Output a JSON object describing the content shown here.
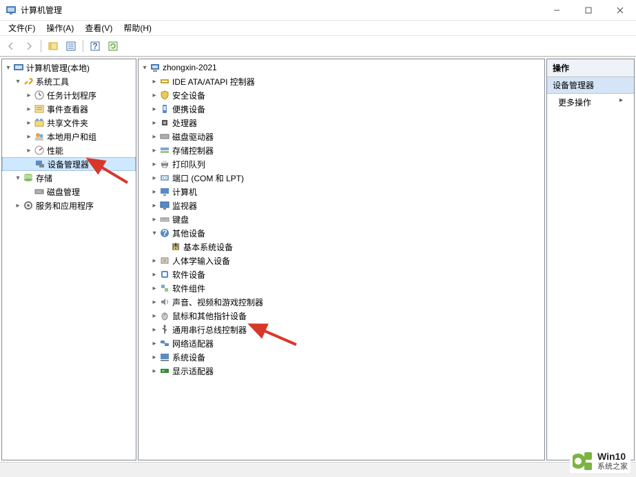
{
  "window": {
    "title": "计算机管理"
  },
  "menu": {
    "file": "文件(F)",
    "action": "操作(A)",
    "view": "查看(V)",
    "help": "帮助(H)"
  },
  "left_tree": {
    "root": "计算机管理(本地)",
    "system_tools": "系统工具",
    "task_scheduler": "任务计划程序",
    "event_viewer": "事件查看器",
    "shared_folders": "共享文件夹",
    "local_users": "本地用户和组",
    "performance": "性能",
    "device_manager": "设备管理器",
    "storage": "存储",
    "disk_management": "磁盘管理",
    "services_apps": "服务和应用程序"
  },
  "center_tree": {
    "root": "zhongxin-2021",
    "ide": "IDE ATA/ATAPI 控制器",
    "security": "安全设备",
    "portable": "便携设备",
    "processors": "处理器",
    "disk_drives": "磁盘驱动器",
    "storage_ctrl": "存储控制器",
    "print_queue": "打印队列",
    "ports": "端口 (COM 和 LPT)",
    "computer": "计算机",
    "monitors": "监视器",
    "keyboards": "键盘",
    "other": "其他设备",
    "other_child": "基本系统设备",
    "hid": "人体学输入设备",
    "software_dev": "软件设备",
    "software_comp": "软件组件",
    "sound": "声音、视频和游戏控制器",
    "mice": "鼠标和其他指针设备",
    "usb": "通用串行总线控制器",
    "network": "网络适配器",
    "system_dev": "系统设备",
    "display": "显示适配器"
  },
  "actions": {
    "header": "操作",
    "section": "设备管理器",
    "more": "更多操作"
  },
  "watermark": {
    "line1": "Win10",
    "line2": "系统之家"
  }
}
